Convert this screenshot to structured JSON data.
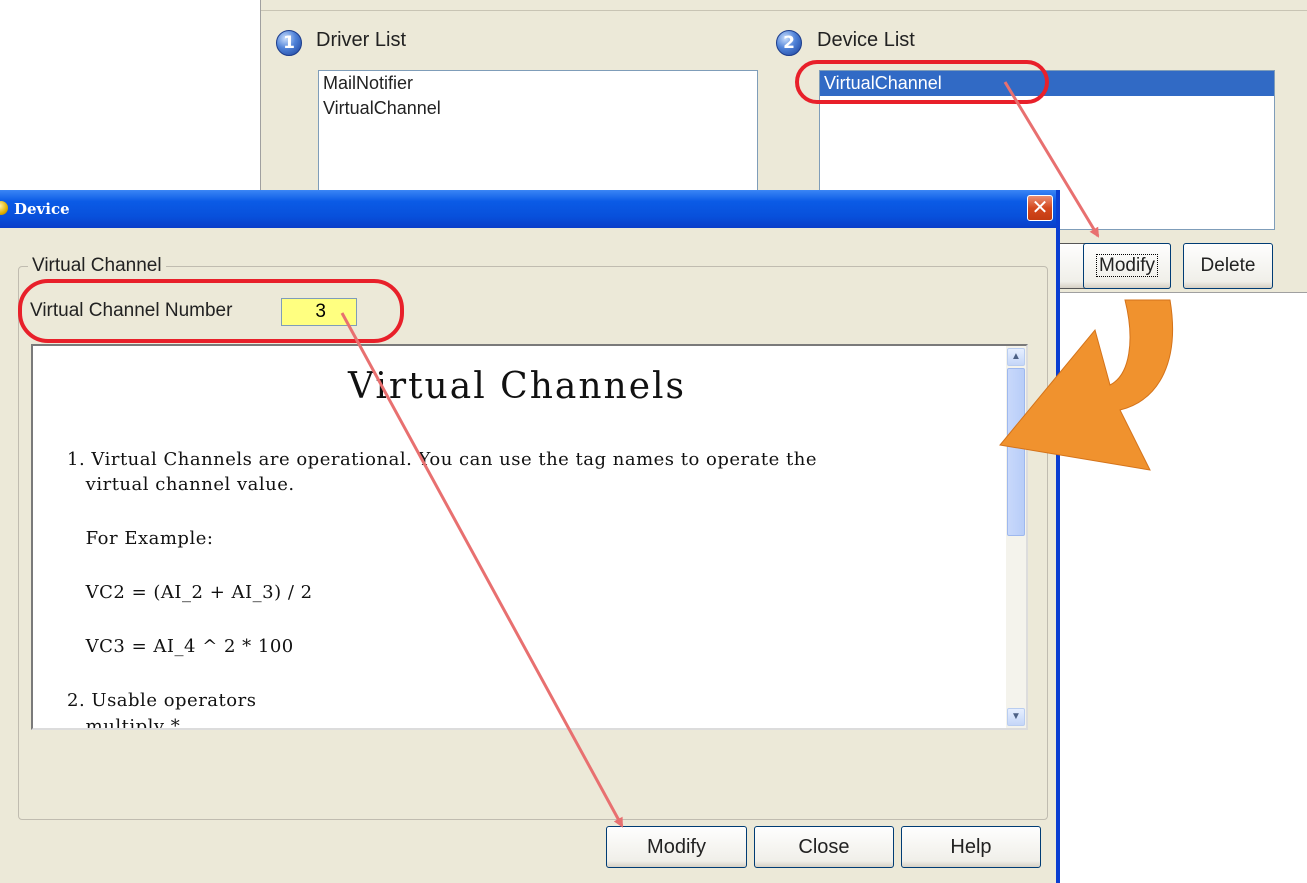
{
  "back_window": {
    "driver_list": {
      "badge": "1",
      "label": "Driver List",
      "items": [
        "MailNotifier",
        "VirtualChannel"
      ]
    },
    "device_list": {
      "badge": "2",
      "label": "Device List",
      "items": [
        "VirtualChannel"
      ],
      "selected_index": 0
    },
    "buttons": {
      "modify": "Modify",
      "delete": "Delete"
    }
  },
  "dialog": {
    "title": "Device",
    "close_glyph": "✕",
    "group_title": "Virtual Channel",
    "channel_number_label": "Virtual Channel Number",
    "channel_number_value": "3",
    "help": {
      "title": "Virtual Channels",
      "lines": [
        "1. Virtual Channels are operational. You can use the tag names to operate the",
        "   virtual channel value.",
        "   For Example:",
        "   VC2 = (AI_2 + AI_3) / 2",
        "   VC3 = AI_4 ^ 2 * 100",
        "2. Usable operators",
        "   multiply *"
      ]
    },
    "buttons": {
      "modify": "Modify",
      "close": "Close",
      "help": "Help"
    }
  },
  "annotation_colors": {
    "highlight": "#e8202a",
    "arrow": "#e87070",
    "curve_arrow": "#f0922e"
  }
}
